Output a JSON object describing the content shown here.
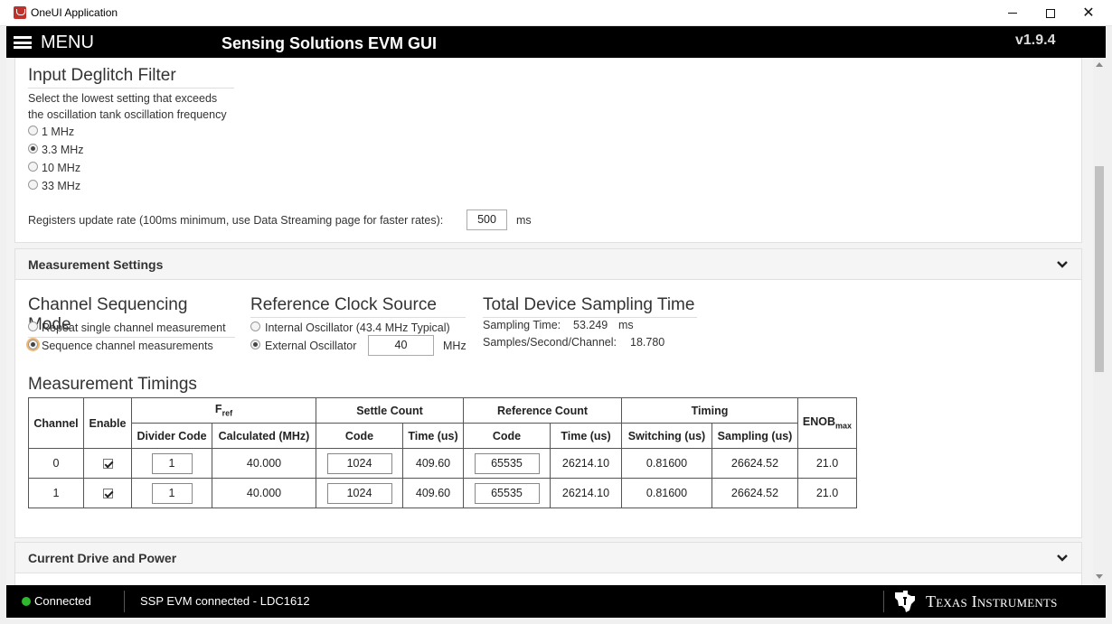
{
  "window": {
    "title": "OneUI Application"
  },
  "header": {
    "menu_label": "MENU",
    "app_title": "Sensing Solutions EVM GUI",
    "version": "v1.9.4"
  },
  "deglitch": {
    "title": "Input Deglitch Filter",
    "desc_line1": "Select the lowest setting that exceeds",
    "desc_line2": "the oscillation tank oscillation frequency",
    "options": [
      "1 MHz",
      "3.3 MHz",
      "10 MHz",
      "33 MHz"
    ],
    "selected": "3.3 MHz",
    "update_rate_label": "Registers update rate (100ms minimum, use Data Streaming page for faster rates):",
    "update_rate_value": "500",
    "update_rate_unit": "ms"
  },
  "measurement": {
    "panel_title": "Measurement Settings",
    "sequencing": {
      "title": "Channel Sequencing Mode",
      "options": [
        "Repeat single channel measurement",
        "Sequence channel measurements"
      ],
      "selected": "Sequence channel measurements"
    },
    "ref_clock": {
      "title": "Reference Clock Source",
      "internal_label": "Internal Oscillator (43.4 MHz Typical)",
      "external_label": "External Oscillator",
      "external_value": "40",
      "external_unit": "MHz",
      "selected": "External Oscillator"
    },
    "sampling": {
      "title": "Total Device Sampling Time",
      "sampling_time_label": "Sampling Time:",
      "sampling_time_value": "53.249",
      "sampling_time_unit": "ms",
      "sps_label": "Samples/Second/Channel:",
      "sps_value": "18.780"
    },
    "timings": {
      "title": "Measurement Timings",
      "headers": {
        "channel": "Channel",
        "enable": "Enable",
        "fref": "F",
        "fref_sub": "ref",
        "settle_count": "Settle Count",
        "reference_count": "Reference Count",
        "timing": "Timing",
        "enob": "ENOB",
        "enob_sub": "max",
        "divider_code": "Divider Code",
        "calculated": "Calculated (MHz)",
        "code": "Code",
        "time_us": "Time (us)",
        "switching": "Switching (us)",
        "sampling": "Sampling (us)"
      },
      "rows": [
        {
          "channel": "0",
          "enabled": true,
          "divider": "1",
          "calc": "40.000",
          "settle_code": "1024",
          "settle_time": "409.60",
          "ref_code": "65535",
          "ref_time": "26214.10",
          "switching": "0.81600",
          "sampling": "26624.52",
          "enob": "21.0"
        },
        {
          "channel": "1",
          "enabled": true,
          "divider": "1",
          "calc": "40.000",
          "settle_code": "1024",
          "settle_time": "409.60",
          "ref_code": "65535",
          "ref_time": "26214.10",
          "switching": "0.81600",
          "sampling": "26624.52",
          "enob": "21.0"
        }
      ]
    }
  },
  "current_drive": {
    "panel_title": "Current Drive and Power"
  },
  "status": {
    "connection": "Connected",
    "message": "SSP EVM connected - LDC1612",
    "brand": "Texas Instruments",
    "connected_color": "#2eb82e"
  }
}
